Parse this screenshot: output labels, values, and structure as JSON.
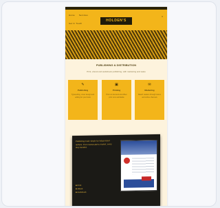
{
  "header": {
    "logo_text": "HOLDEN'S",
    "nav_left_1": [
      "Home",
      "Services"
    ],
    "nav_left_2": [
      "Get In Touch"
    ],
    "nav_right": "≡"
  },
  "section": {
    "title": "PUBLISHING & DISTRIBUTION",
    "subtitle": "Print, ebook and audiobook publishing, with marketing and sales"
  },
  "features": [
    {
      "icon": "✎",
      "icon_name": "pencil-icon",
      "title": "Publishing",
      "text": "Typesetting, cover design and editing for your book"
    },
    {
      "icon": "▣",
      "icon_name": "book-icon",
      "title": "Printing",
      "text": "Print on demand and offset print runs worldwide"
    },
    {
      "icon": "✉",
      "icon_name": "envelope-icon",
      "title": "Marketing",
      "text": "Reach readers through stores and online channels"
    }
  ],
  "book": {
    "text": "Publishing made simple for independent authors. From manuscript to market, every step handled.",
    "list": [
      "Print",
      "eBook",
      "Audiobook"
    ]
  },
  "colors": {
    "accent": "#f3b51a",
    "dark": "#1f1a0a",
    "background": "#fdf3dd"
  }
}
